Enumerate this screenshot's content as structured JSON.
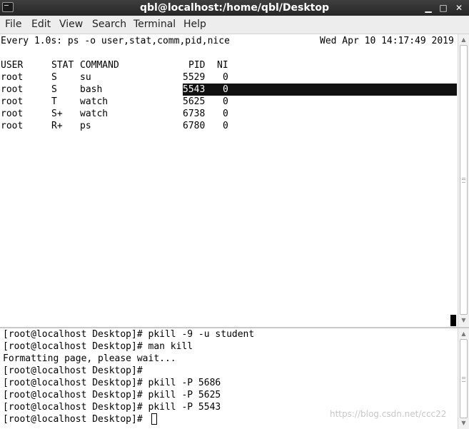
{
  "window": {
    "title": "qbl@localhost:/home/qbl/Desktop",
    "buttons": {
      "minimize": "▁",
      "maximize": "□",
      "close": "✕"
    }
  },
  "menu": [
    "File",
    "Edit",
    "View",
    "Search",
    "Terminal",
    "Help"
  ],
  "top_terminal": {
    "watch_header": "Every 1.0s: ps -o user,stat,comm,pid,nice",
    "timestamp": "Wed Apr 10 14:17:49 2019",
    "columns": {
      "user": "USER",
      "stat": "STAT",
      "command": "COMMAND",
      "pid": "PID",
      "ni": "NI"
    },
    "processes": [
      {
        "user": "root",
        "stat": "S",
        "command": "su",
        "pid": "5529",
        "ni": "0"
      },
      {
        "user": "root",
        "stat": "S",
        "command": "bash",
        "pid": "5543",
        "ni": "0"
      },
      {
        "user": "root",
        "stat": "T",
        "command": "watch",
        "pid": "5625",
        "ni": "0"
      },
      {
        "user": "root",
        "stat": "S+",
        "command": "watch",
        "pid": "6738",
        "ni": "0"
      },
      {
        "user": "root",
        "stat": "R+",
        "command": "ps",
        "pid": "6780",
        "ni": "0"
      }
    ]
  },
  "bottom_terminal": {
    "lines": [
      "[root@localhost Desktop]# pkill -9 -u student",
      "[root@localhost Desktop]# man kill",
      "Formatting page, please wait...",
      "[root@localhost Desktop]#",
      "[root@localhost Desktop]# pkill -P 5686",
      "[root@localhost Desktop]# pkill -P 5625",
      "[root@localhost Desktop]# pkill -P 5543"
    ],
    "prompt": "[root@localhost Desktop]# "
  },
  "scrollbar_icons": {
    "up": "▲",
    "down": "▼"
  },
  "watermark": "https://blog.csdn.net/ccc22"
}
